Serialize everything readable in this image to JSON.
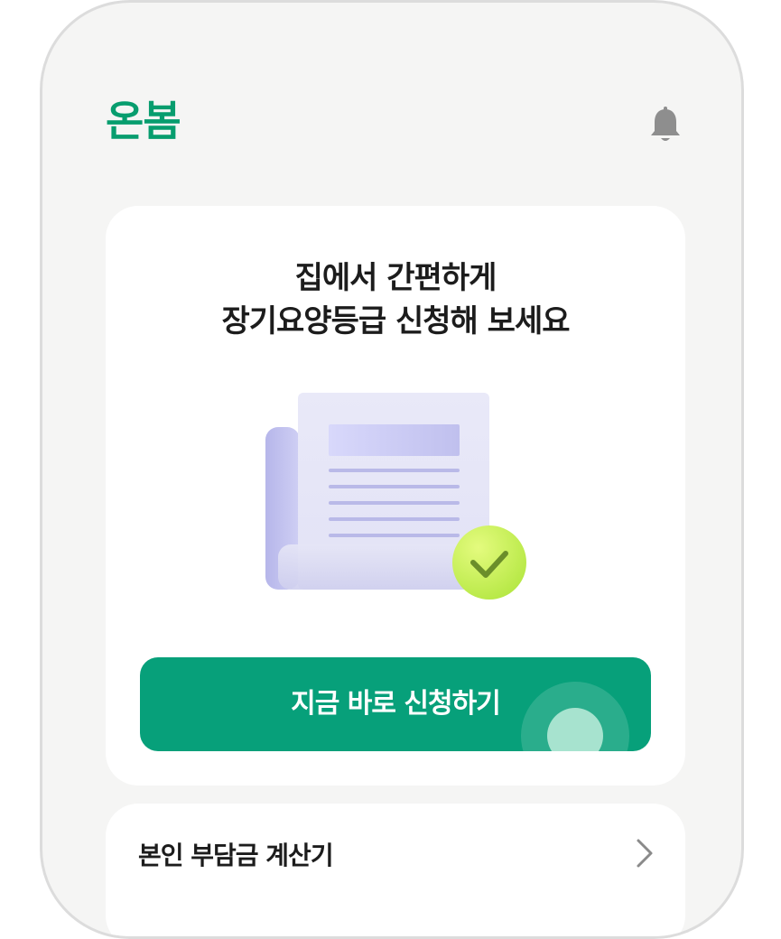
{
  "app": {
    "logo_text": "온봄"
  },
  "header": {
    "notification_icon": "bell-icon"
  },
  "hero_card": {
    "headline_line1": "집에서 간편하게",
    "headline_line2": "장기요양등급 신청해 보세요",
    "illustration": "document-check-illustration",
    "apply_button_label": "지금 바로 신청하기"
  },
  "calculator_card": {
    "label": "본인 부담금 계산기",
    "chevron_icon": "chevron-right-icon"
  },
  "colors": {
    "brand": "#079d6e",
    "button": "#07a07a",
    "background": "#f5f5f4",
    "card": "#ffffff",
    "text": "#1c1c1c",
    "check_badge": "#c8ef5a"
  }
}
